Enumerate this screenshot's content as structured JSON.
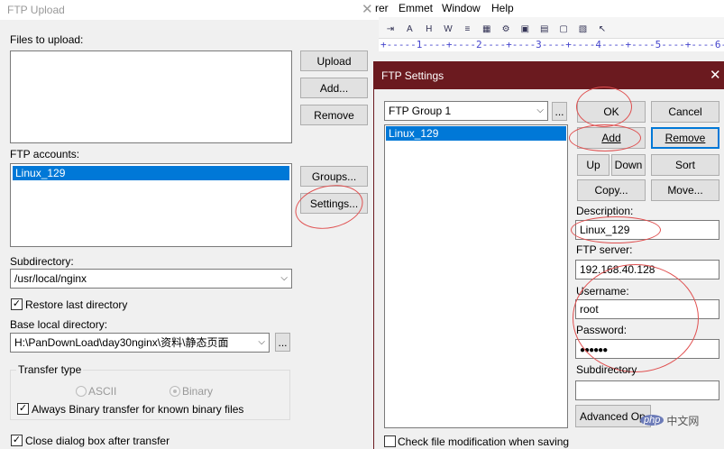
{
  "ftp_upload": {
    "title": "FTP Upload",
    "files_label": "Files to upload:",
    "upload_btn": "Upload",
    "add_btn": "Add...",
    "remove_btn": "Remove",
    "accounts_label": "FTP accounts:",
    "accounts": [
      "Linux_129"
    ],
    "groups_btn": "Groups...",
    "settings_btn": "Settings...",
    "subdir_label": "Subdirectory:",
    "subdir_value": "/usr/local/nginx",
    "restore_label": "Restore last directory",
    "base_local_label": "Base local directory:",
    "base_local_value": "H:\\PanDownLoad\\day30nginx\\资料\\静态页面",
    "browse_btn": "...",
    "transfer_type_label": "Transfer type",
    "ascii_label": "ASCII",
    "binary_label": "Binary",
    "always_binary_label": "Always Binary transfer for known binary files",
    "close_dialog_label": "Close dialog box after transfer"
  },
  "editor": {
    "menu": [
      "rer",
      "Emmet",
      "Window",
      "Help"
    ],
    "ruler": "+-----1----+----2----+----3----+----4----+----5----+----6---"
  },
  "ftp_settings": {
    "title": "FTP Settings",
    "group_value": "FTP Group 1",
    "browse_btn": "...",
    "accounts": [
      "Linux_129"
    ],
    "ok_btn": "OK",
    "cancel_btn": "Cancel",
    "add_btn": "Add",
    "remove_btn": "Remove",
    "up_btn": "Up",
    "down_btn": "Down",
    "sort_btn": "Sort",
    "copy_btn": "Copy...",
    "move_btn": "Move...",
    "description_label": "Description:",
    "description_value": "Linux_129",
    "server_label": "FTP server:",
    "server_value": "192.168.40.128",
    "username_label": "Username:",
    "username_value": "root",
    "password_label": "Password:",
    "password_value": "●●●●●●",
    "subdir_label": "Subdirectory",
    "subdir_value": "",
    "advanced_btn": "Advanced Op",
    "check_mod_label": "Check file modification when saving"
  },
  "watermark": "php 中文网",
  "colors": {
    "accent": "#0078d7",
    "titlebar": "#6b1a1f",
    "annotation": "#e05050"
  }
}
